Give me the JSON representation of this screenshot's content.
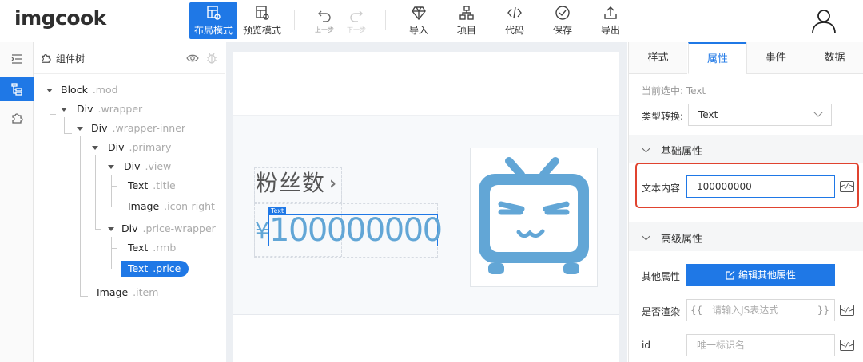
{
  "logo": "imgcook",
  "toolbar": {
    "layout_mode": "布局模式",
    "preview_mode": "预览模式",
    "undo": "上一步",
    "redo": "下一步",
    "import": "导入",
    "project": "项目",
    "code": "代码",
    "save": "保存",
    "export": "导出"
  },
  "tree": {
    "title": "组件树",
    "nodes": [
      {
        "tag": "Block",
        "cls": ".mod"
      },
      {
        "tag": "Div",
        "cls": ".wrapper"
      },
      {
        "tag": "Div",
        "cls": ".wrapper-inner"
      },
      {
        "tag": "Div",
        "cls": ".primary"
      },
      {
        "tag": "Div",
        "cls": ".view"
      },
      {
        "tag": "Text",
        "cls": ".title"
      },
      {
        "tag": "Image",
        "cls": ".icon-right"
      },
      {
        "tag": "Div",
        "cls": ".price-wrapper"
      },
      {
        "tag": "Text",
        "cls": ".rmb"
      },
      {
        "tag": "Text",
        "cls": ".price"
      },
      {
        "tag": "Image",
        "cls": ".item"
      }
    ]
  },
  "canvas": {
    "title_text": "粉丝数",
    "arrow": "›",
    "rmb": "¥",
    "price": "100000000",
    "tag": "Text"
  },
  "panel": {
    "tabs": [
      "样式",
      "属性",
      "事件",
      "数据"
    ],
    "current_selection": "当前选中: Text",
    "type_convert_label": "类型转换:",
    "type_convert_value": "Text",
    "basic_section": "基础属性",
    "text_content_label": "文本内容",
    "text_content_value": "100000000",
    "advanced_section": "高级属性",
    "other_attrs_label": "其他属性",
    "edit_other_attrs": "编辑其他属性",
    "render_label": "是否渲染",
    "render_open": "{{",
    "render_placeholder": "请输入JS表达式",
    "render_close": "}}",
    "id_label": "id",
    "id_placeholder": "唯一标识名"
  },
  "colors": {
    "accent": "#1f78e6",
    "highlight_border": "#e0432f",
    "bili_blue": "#62a6d6"
  }
}
